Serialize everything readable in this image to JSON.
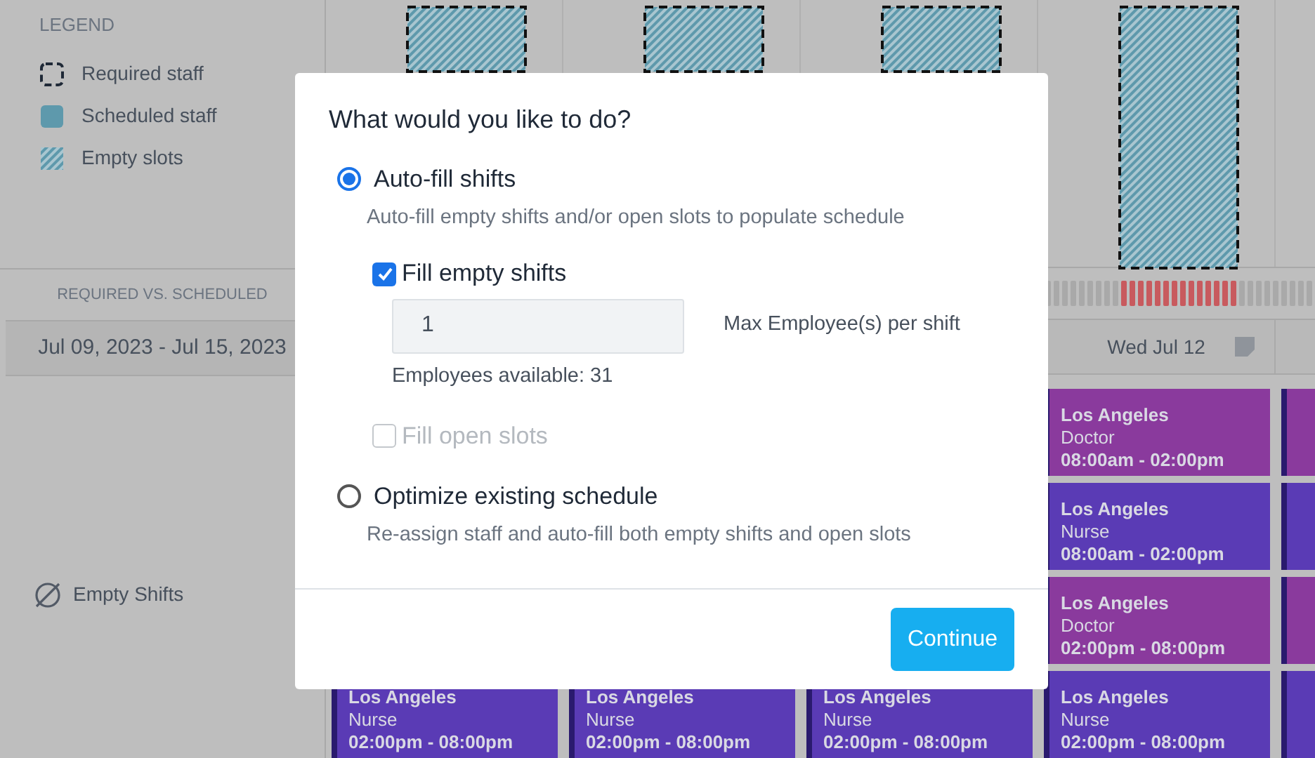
{
  "legend": {
    "title": "LEGEND",
    "items": [
      {
        "kind": "dashed",
        "label": "Required staff"
      },
      {
        "kind": "solid",
        "label": "Scheduled staff"
      },
      {
        "kind": "hatched",
        "label": "Empty slots"
      }
    ]
  },
  "sidebar": {
    "section_label": "REQUIRED VS. SCHEDULED",
    "date_range": "Jul 09, 2023 - Jul 15, 2023",
    "empty_shifts": "Empty Shifts"
  },
  "day_headers": [
    {
      "label": "Wed Jul 12",
      "note": true
    }
  ],
  "shift_columns": [
    {
      "cards": [
        {
          "color": "#5a3bb5",
          "location": "Los Angeles",
          "role": "Nurse",
          "time": "02:00pm - 08:00pm"
        }
      ]
    },
    {
      "cards": [
        {
          "color": "#5a3bb5",
          "location": "Los Angeles",
          "role": "Nurse",
          "time": "02:00pm - 08:00pm"
        }
      ]
    },
    {
      "cards": [
        {
          "color": "#5a3bb5",
          "location": "Los Angeles",
          "role": "Nurse",
          "time": "02:00pm - 08:00pm"
        }
      ]
    },
    {
      "cards": [
        {
          "color": "#8a3a9d",
          "location": "Los Angeles",
          "role": "Doctor",
          "time": "08:00am - 02:00pm"
        },
        {
          "color": "#5a3bb5",
          "location": "Los Angeles",
          "role": "Nurse",
          "time": "08:00am - 02:00pm"
        },
        {
          "color": "#8a3a9d",
          "location": "Los Angeles",
          "role": "Doctor",
          "time": "02:00pm - 08:00pm"
        },
        {
          "color": "#5a3bb5",
          "location": "Los Angeles",
          "role": "Nurse",
          "time": "02:00pm - 08:00pm"
        }
      ]
    },
    {
      "cards": [
        {
          "color": "#8a3a9d"
        },
        {
          "color": "#5a3bb5"
        },
        {
          "color": "#8a3a9d"
        },
        {
          "color": "#5a3bb5"
        }
      ]
    }
  ],
  "dialog": {
    "title": "What would you like to do?",
    "options": [
      {
        "label": "Auto-fill shifts",
        "description": "Auto-fill empty shifts and/or open slots to populate schedule",
        "selected": true,
        "fill_empty": {
          "label": "Fill empty shifts",
          "checked": true,
          "value": "1",
          "side_label": "Max Employee(s) per shift",
          "note": "Employees available: 31"
        },
        "fill_open": {
          "label": "Fill open slots",
          "checked": false,
          "disabled": true
        }
      },
      {
        "label": "Optimize existing schedule",
        "description": "Re-assign staff and auto-fill both empty shifts and open slots",
        "selected": false
      }
    ],
    "button": "Continue"
  }
}
